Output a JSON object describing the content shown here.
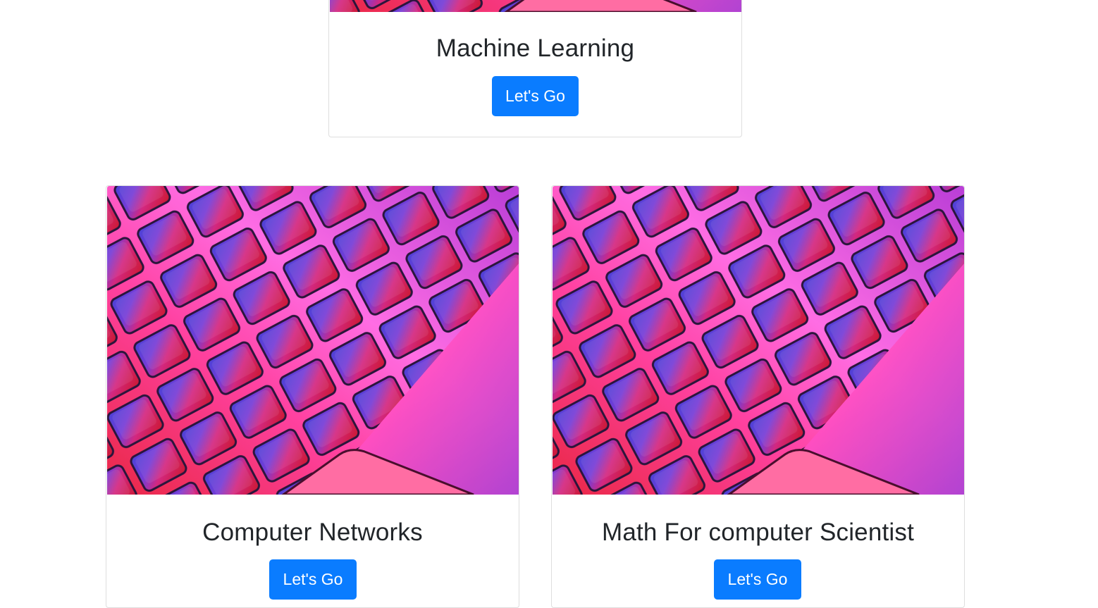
{
  "cards": [
    {
      "title": "Machine Learning",
      "button_label": "Let's Go",
      "image_name": "keyboard-image"
    },
    {
      "title": "Computer Networks",
      "button_label": "Let's Go",
      "image_name": "keyboard-image"
    },
    {
      "title": "Math For computer Scientist",
      "button_label": "Let's Go",
      "image_name": "keyboard-image"
    }
  ],
  "colors": {
    "button": "#0a7cff",
    "text": "#212529",
    "border": "#dedede",
    "image_pink": "#ff3fbf",
    "image_red": "#c8121e",
    "image_blue": "#3c3ce6",
    "image_magenta": "#ff6be0"
  }
}
